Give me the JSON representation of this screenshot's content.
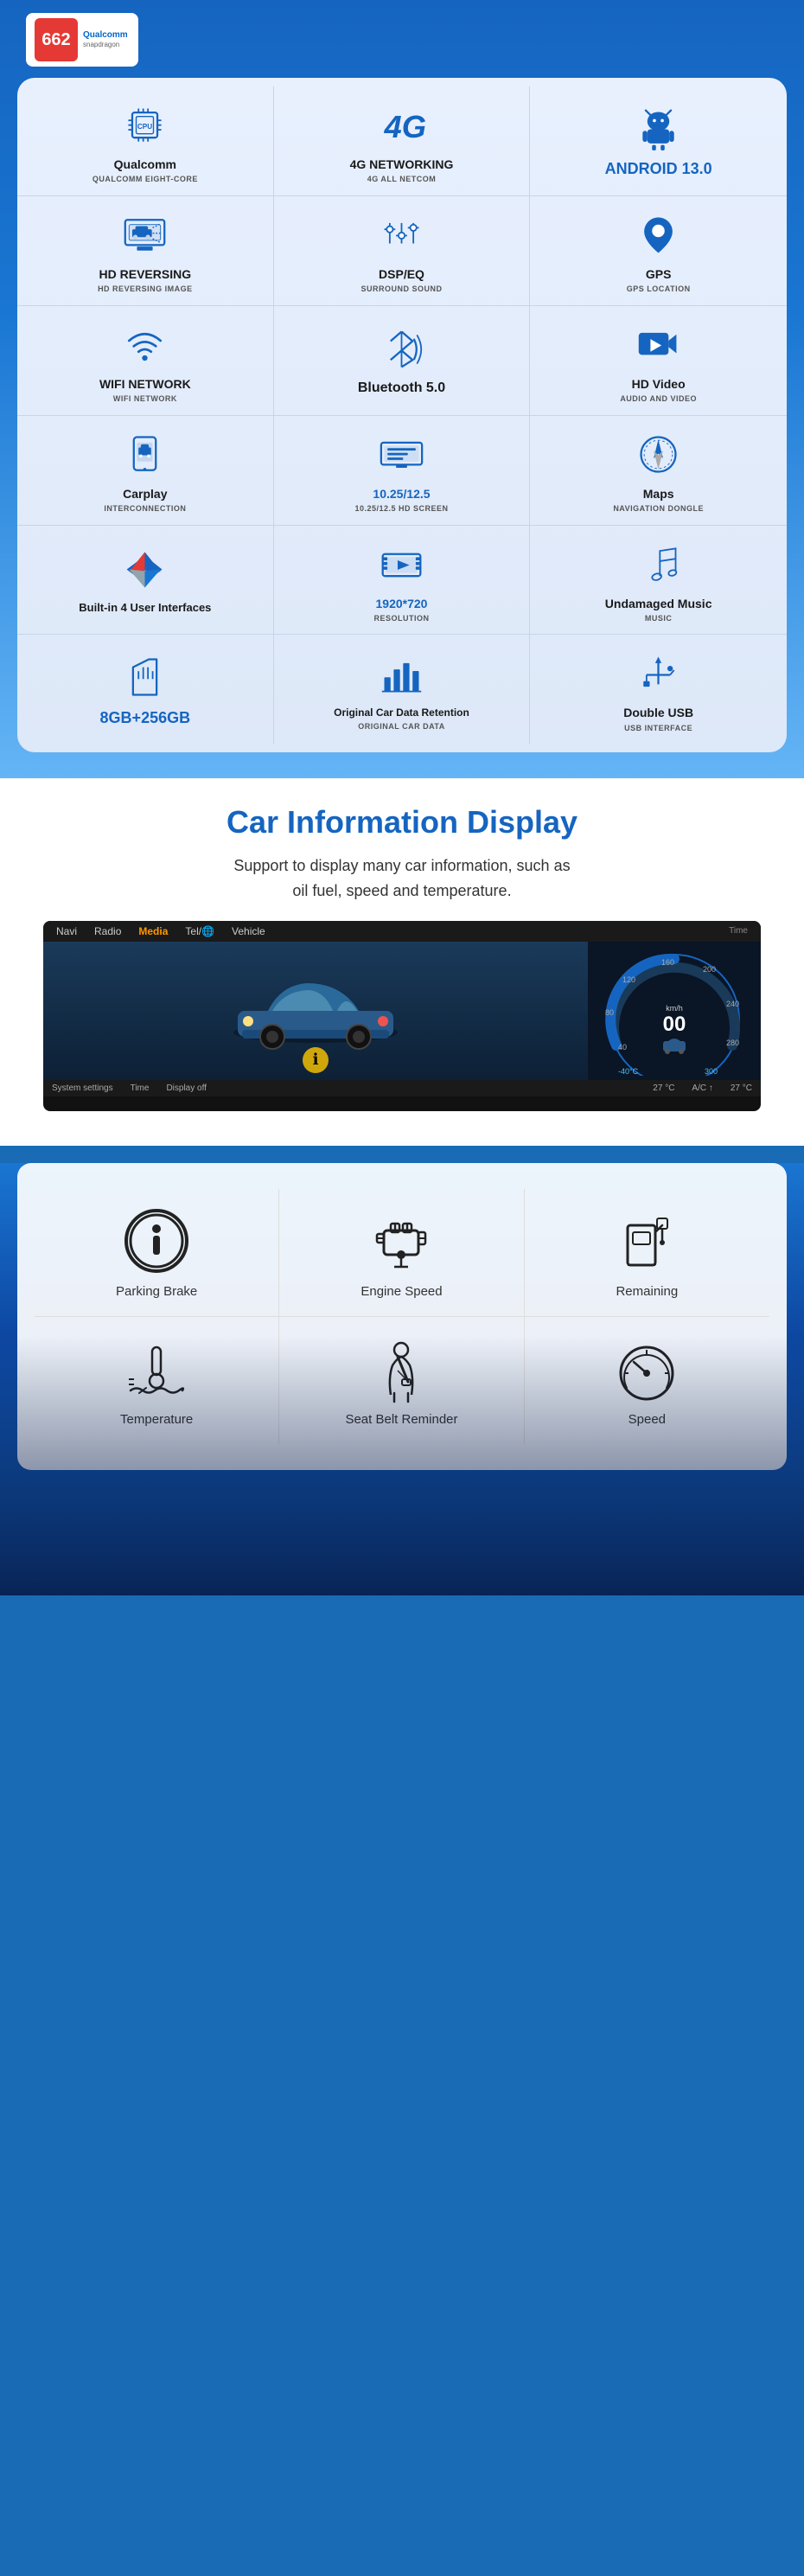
{
  "badge": {
    "number": "662",
    "brand": "Qualcomm",
    "sub": "snapdragon"
  },
  "features": [
    {
      "id": "qualcomm",
      "title": "Qualcomm",
      "subtitle": "QUALCOMM EIGHT-CORE",
      "icon": "cpu",
      "titleStyle": "normal"
    },
    {
      "id": "4g",
      "title": "4G NETWORKING",
      "subtitle": "4G ALL NETCOM",
      "icon": "4g",
      "titleStyle": "normal"
    },
    {
      "id": "android",
      "title": "ANDROID 13.0",
      "subtitle": "",
      "icon": "android",
      "titleStyle": "android"
    },
    {
      "id": "hd-reversing",
      "title": "HD REVERSING",
      "subtitle": "HD REVERSING IMAGE",
      "icon": "camera",
      "titleStyle": "normal"
    },
    {
      "id": "dsp",
      "title": "DSP/EQ",
      "subtitle": "SURROUND SOUND",
      "icon": "eq",
      "titleStyle": "normal"
    },
    {
      "id": "gps",
      "title": "GPS",
      "subtitle": "GPS LOCATION",
      "icon": "gps",
      "titleStyle": "normal"
    },
    {
      "id": "wifi",
      "title": "WIFI NETWORK",
      "subtitle": "WIFI NETWORK",
      "icon": "wifi",
      "titleStyle": "normal"
    },
    {
      "id": "bluetooth",
      "title": "Bluetooth 5.0",
      "subtitle": "",
      "icon": "bluetooth",
      "titleStyle": "bluetooth"
    },
    {
      "id": "hdvideo",
      "title": "HD Video",
      "subtitle": "AUDIO AND VIDEO",
      "icon": "video",
      "titleStyle": "normal"
    },
    {
      "id": "carplay",
      "title": "Carplay",
      "subtitle": "INTERCONNECTION",
      "icon": "carplay",
      "titleStyle": "normal"
    },
    {
      "id": "screen",
      "title": "10.25/12.5",
      "subtitle": "10.25/12.5 HD SCREEN",
      "icon": "screen",
      "titleStyle": "blue"
    },
    {
      "id": "maps",
      "title": "Maps",
      "subtitle": "NAVIGATION DONGLE",
      "icon": "maps",
      "titleStyle": "normal"
    },
    {
      "id": "interfaces",
      "title": "Built-in 4 User Interfaces",
      "subtitle": "",
      "icon": "interfaces",
      "titleStyle": "normal"
    },
    {
      "id": "resolution",
      "title": "1920*720",
      "subtitle": "Resolution",
      "icon": "resolution",
      "titleStyle": "resolution-blue"
    },
    {
      "id": "music",
      "title": "Undamaged Music",
      "subtitle": "MUSIC",
      "icon": "music",
      "titleStyle": "normal"
    },
    {
      "id": "storage",
      "title": "8GB+256GB",
      "subtitle": "",
      "icon": "storage",
      "titleStyle": "storage"
    },
    {
      "id": "cardata",
      "title": "Original Car Data Retention",
      "subtitle": "ORIGINAL CAR DATA",
      "icon": "cardata",
      "titleStyle": "normal"
    },
    {
      "id": "usb",
      "title": "Double USB",
      "subtitle": "USB INTERFACE",
      "icon": "usb",
      "titleStyle": "normal"
    }
  ],
  "car_info": {
    "title": "Car Information Display",
    "description": "Support to display many car information, such as\noil fuel, speed and temperature.",
    "dashboard": {
      "nav_items": [
        "Navi",
        "Radio",
        "Media",
        "Tel/🌐",
        "Vehicle"
      ],
      "active_nav": "Media",
      "bottom_items": [
        "System settings",
        "Time",
        "Display off"
      ],
      "temp_left": "27 °C",
      "temp_right": "27 °C"
    }
  },
  "info_items": [
    {
      "id": "parking-brake",
      "label": "Parking Brake",
      "icon": "parking"
    },
    {
      "id": "engine-speed",
      "label": "Engine Speed",
      "icon": "engine"
    },
    {
      "id": "remaining",
      "label": "Remaining",
      "icon": "fuel"
    },
    {
      "id": "temperature",
      "label": "Temperature",
      "icon": "temp"
    },
    {
      "id": "seat-belt",
      "label": "Seat Belt Reminder",
      "icon": "seatbelt"
    },
    {
      "id": "speed",
      "label": "Speed",
      "icon": "speedometer"
    }
  ]
}
